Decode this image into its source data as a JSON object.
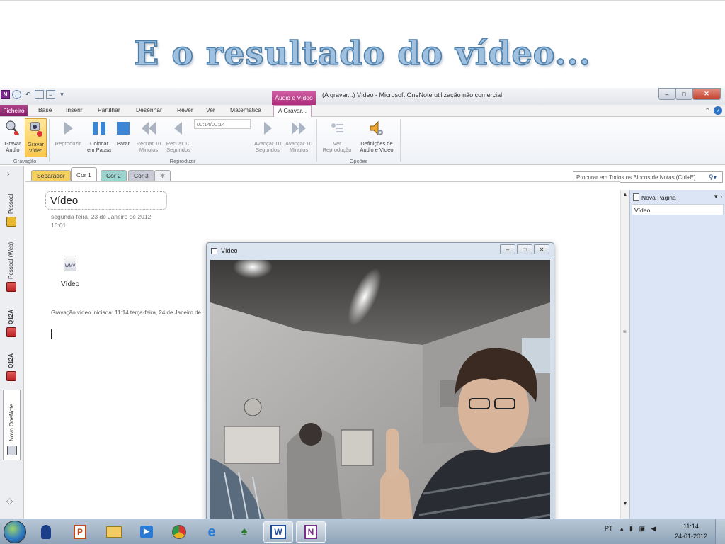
{
  "slide": {
    "title": "E o resultado do vídeo..."
  },
  "window": {
    "context_tab": "Áudio e Vídeo",
    "title": "(A gravar...) Vídeo - Microsoft OneNote utilização não comercial"
  },
  "menu": {
    "file": "Ficheiro",
    "items": [
      "Base",
      "Inserir",
      "Partilhar",
      "Desenhar",
      "Rever",
      "Ver",
      "Matemática"
    ],
    "active": "A Gravar..."
  },
  "ribbon": {
    "gravar_audio": [
      "Gravar",
      "Áudio"
    ],
    "gravar_video": [
      "Gravar",
      "Vídeo"
    ],
    "group_gravacao": "Gravação",
    "reproduzir": "Reproduzir",
    "colocar_pausa": [
      "Colocar",
      "em Pausa"
    ],
    "parar": "Parar",
    "recuar10min": [
      "Recuar 10",
      "Minutos"
    ],
    "recuar10seg": [
      "Recuar 10",
      "Segundos"
    ],
    "timecode": "00:14/00:14",
    "avancar10seg": [
      "Avançar 10",
      "Segundos"
    ],
    "avancar10min": [
      "Avançar 10",
      "Minutos"
    ],
    "group_reproduzir": "Reproduzir",
    "ver_reproducao": [
      "Ver",
      "Reprodução"
    ],
    "definicoes": [
      "Definições de",
      "Áudio e Vídeo"
    ],
    "group_opcoes": "Opções"
  },
  "notebooks": [
    "Pessoal",
    "Pessoal (Web)",
    "Q12A",
    "Q12A",
    "Novo OneNote"
  ],
  "sections": [
    "Separador",
    "Cor 1",
    "Cor 2",
    "Cor 3"
  ],
  "search": {
    "placeholder": "Procurar em Todos os Blocos de Notas (Ctrl+E)"
  },
  "page": {
    "title": "Vídeo",
    "date": "segunda-feira, 23 de Janeiro de 2012",
    "time": "16:01",
    "file_badge": "WMV",
    "file_label": "Vídeo",
    "recording_note": "Gravação vídeo iniciada: 11:14 terça-feira, 24 de Janeiro de"
  },
  "pages_pane": {
    "new_page": "Nova Página",
    "items": [
      "Vídeo"
    ]
  },
  "video_window": {
    "title": "Vídeo"
  },
  "taskbar": {
    "lang": "PT",
    "time": "11:14",
    "date": "24-01-2012"
  }
}
